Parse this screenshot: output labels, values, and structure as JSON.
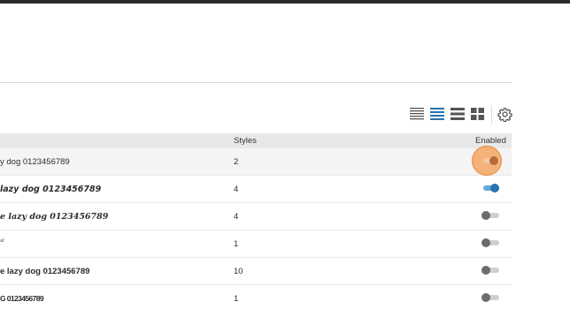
{
  "table": {
    "columns": [
      "Styles",
      "Enabled"
    ],
    "rows": [
      {
        "sample": "y dog 0123456789",
        "styles": "2",
        "enabled": "focused"
      },
      {
        "sample": "lazy dog 0123456789",
        "styles": "4",
        "enabled": "on"
      },
      {
        "sample": "e lazy dog 0123456789",
        "styles": "4",
        "enabled": "off"
      },
      {
        "sample": "ᵃᶠ",
        "styles": "1",
        "enabled": "off"
      },
      {
        "sample": "e lazy dog 0123456789",
        "styles": "10",
        "enabled": "off"
      },
      {
        "sample": "G 0123456789",
        "styles": "1",
        "enabled": "off"
      }
    ]
  },
  "view_options": [
    "compact-list-view-icon",
    "list-view-icon",
    "large-list-view-icon",
    "grid-view-icon"
  ],
  "settings_icon": "gear-icon",
  "colors": {
    "accent_blue": "#2674ae",
    "focus_orange": "#f39e54",
    "header_bg": "#e8e8e8"
  }
}
